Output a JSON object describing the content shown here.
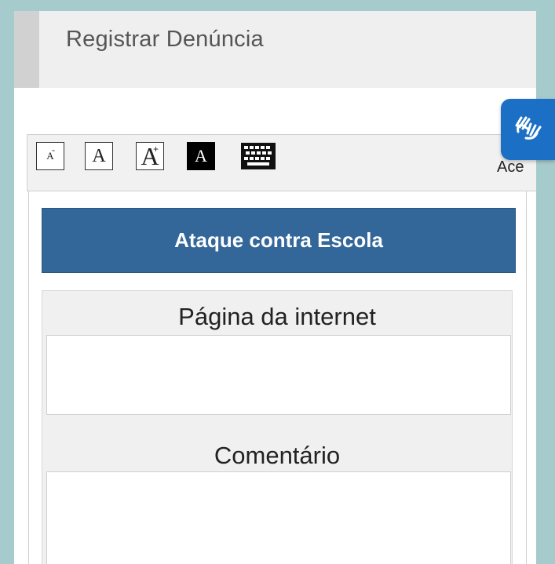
{
  "header": {
    "title": "Registrar Denúncia"
  },
  "accessibility": {
    "badge_icon": "sign-language-hands-icon",
    "toolbar": {
      "decrease_label": "A",
      "decrease_mark": "-",
      "normal_label": "A",
      "increase_label": "A",
      "increase_mark": "+",
      "contrast_label": "A",
      "keyboard_icon": "keyboard-icon",
      "cut_label": "Ace"
    }
  },
  "form": {
    "category_button": "Ataque contra Escola",
    "fields": [
      {
        "label": "Página da internet",
        "value": ""
      },
      {
        "label": "Comentário",
        "value": ""
      }
    ]
  },
  "colors": {
    "frame": "#a6cbcc",
    "header_bg": "#efefef",
    "category_bg": "#336699",
    "access_badge": "#1b6fc4"
  }
}
